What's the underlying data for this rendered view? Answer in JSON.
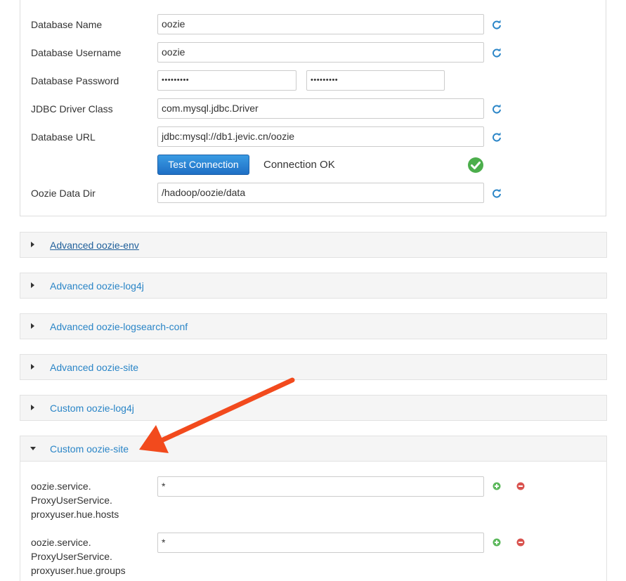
{
  "db": {
    "name_label": "Database Name",
    "name_value": "oozie",
    "user_label": "Database Username",
    "user_value": "oozie",
    "pass_label": "Database Password",
    "pass_value": "•••••••••",
    "pass_confirm_value": "•••••••••",
    "driver_label": "JDBC Driver Class",
    "driver_value": "com.mysql.jdbc.Driver",
    "url_label": "Database URL",
    "url_value": "jdbc:mysql://db1.jevic.cn/oozie",
    "test_button": "Test Connection",
    "status_text": "Connection OK",
    "datadir_label": "Oozie Data Dir",
    "datadir_value": "/hadoop/oozie/data"
  },
  "sections": [
    {
      "title": "Advanced oozie-env",
      "expanded": false
    },
    {
      "title": "Advanced oozie-log4j",
      "expanded": false
    },
    {
      "title": "Advanced oozie-logsearch-conf",
      "expanded": false
    },
    {
      "title": "Advanced oozie-site",
      "expanded": false
    },
    {
      "title": "Custom oozie-log4j",
      "expanded": false
    },
    {
      "title": "Custom oozie-site",
      "expanded": true
    }
  ],
  "custom_site": {
    "props": [
      {
        "name": "oozie.service.\nProxyUserService.\nproxyuser.hue.hosts",
        "value": "*"
      },
      {
        "name": "oozie.service.\nProxyUserService.\nproxyuser.hue.groups",
        "value": "*"
      }
    ]
  },
  "colors": {
    "link": "#2a85c7",
    "add": "#5cb85c",
    "remove": "#d9534f",
    "annotation_arrow": "#f24a1d"
  },
  "icons": [
    "refresh-icon",
    "check-circle-icon",
    "plus-circle-icon",
    "minus-circle-icon",
    "caret-right-icon",
    "caret-down-icon"
  ]
}
